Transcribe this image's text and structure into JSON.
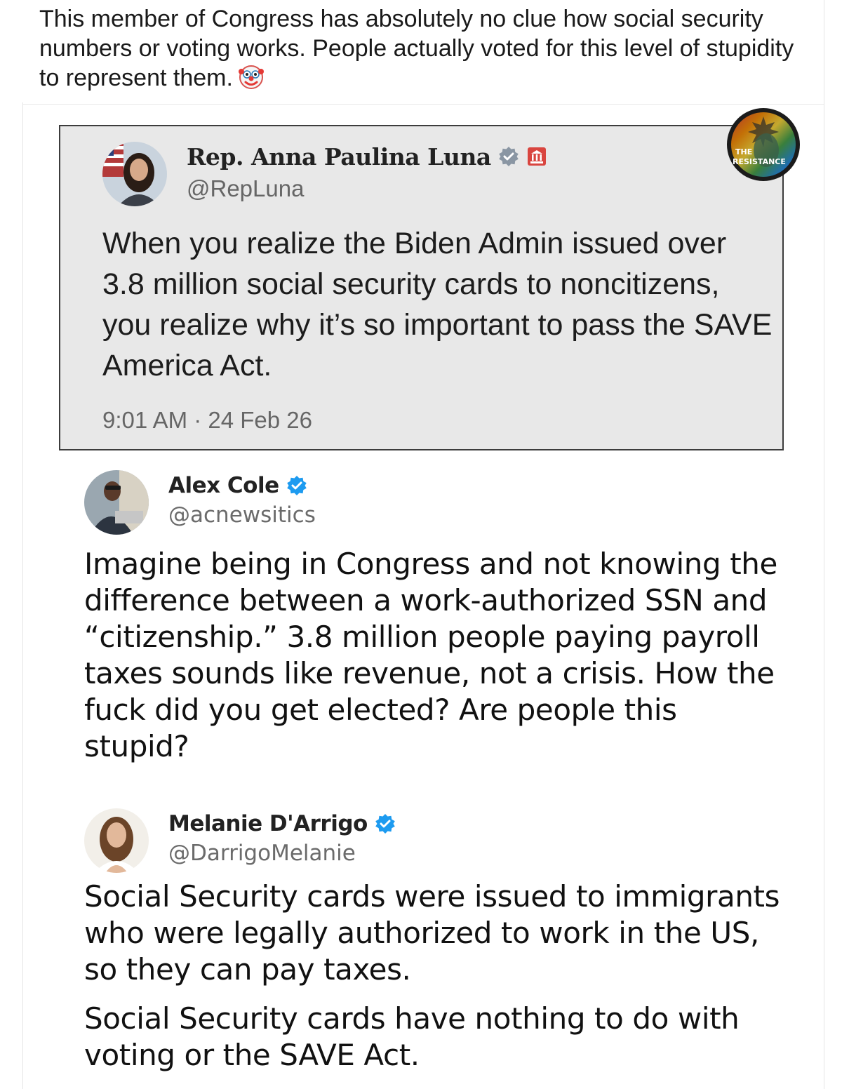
{
  "post": {
    "caption": "This member of Congress has absolutely no clue how social security numbers or voting works. People actually voted for this level of stupidity to represent them.",
    "caption_emoji": "clown-face-emoji"
  },
  "quoted_tweet": {
    "name": "Rep. Anna Paulina Luna",
    "handle": "@RepLuna",
    "text": "When you realize the Biden Admin issued over 3.8 million social security cards to noncitizens, you realize why it’s so important to pass the SAVE America Act.",
    "timestamp": "9:01 AM · 24 Feb 26",
    "verified_icon": "verified-gray-badge-icon",
    "affiliation_icon": "government-building-icon",
    "overlay_badge_text_line1": "THE",
    "overlay_badge_text_line2": "RESISTANCE"
  },
  "replies": [
    {
      "name": "Alex Cole",
      "handle": "@acnewsitics",
      "verified_icon": "verified-blue-badge-icon",
      "paragraphs": [
        "Imagine being in Congress and not knowing the difference between a work-authorized SSN and “citizenship.” 3.8 million people paying payroll taxes sounds like revenue, not a crisis. How the fuck did you get elected? Are people this stupid?"
      ]
    },
    {
      "name": "Melanie D'Arrigo",
      "handle": "@DarrigoMelanie",
      "verified_icon": "verified-blue-badge-icon",
      "paragraphs": [
        "Social Security cards were issued to immigrants who were legally authorized to work in the US, so they can pay taxes.",
        "Social Security cards have nothing to do with voting or the SAVE Act."
      ]
    }
  ],
  "colors": {
    "verified_blue": "#1d9bf0",
    "verified_gray": "#8a96a3",
    "quote_card_bg": "#e8e8e8",
    "handle_gray": "#6b6b6b"
  }
}
